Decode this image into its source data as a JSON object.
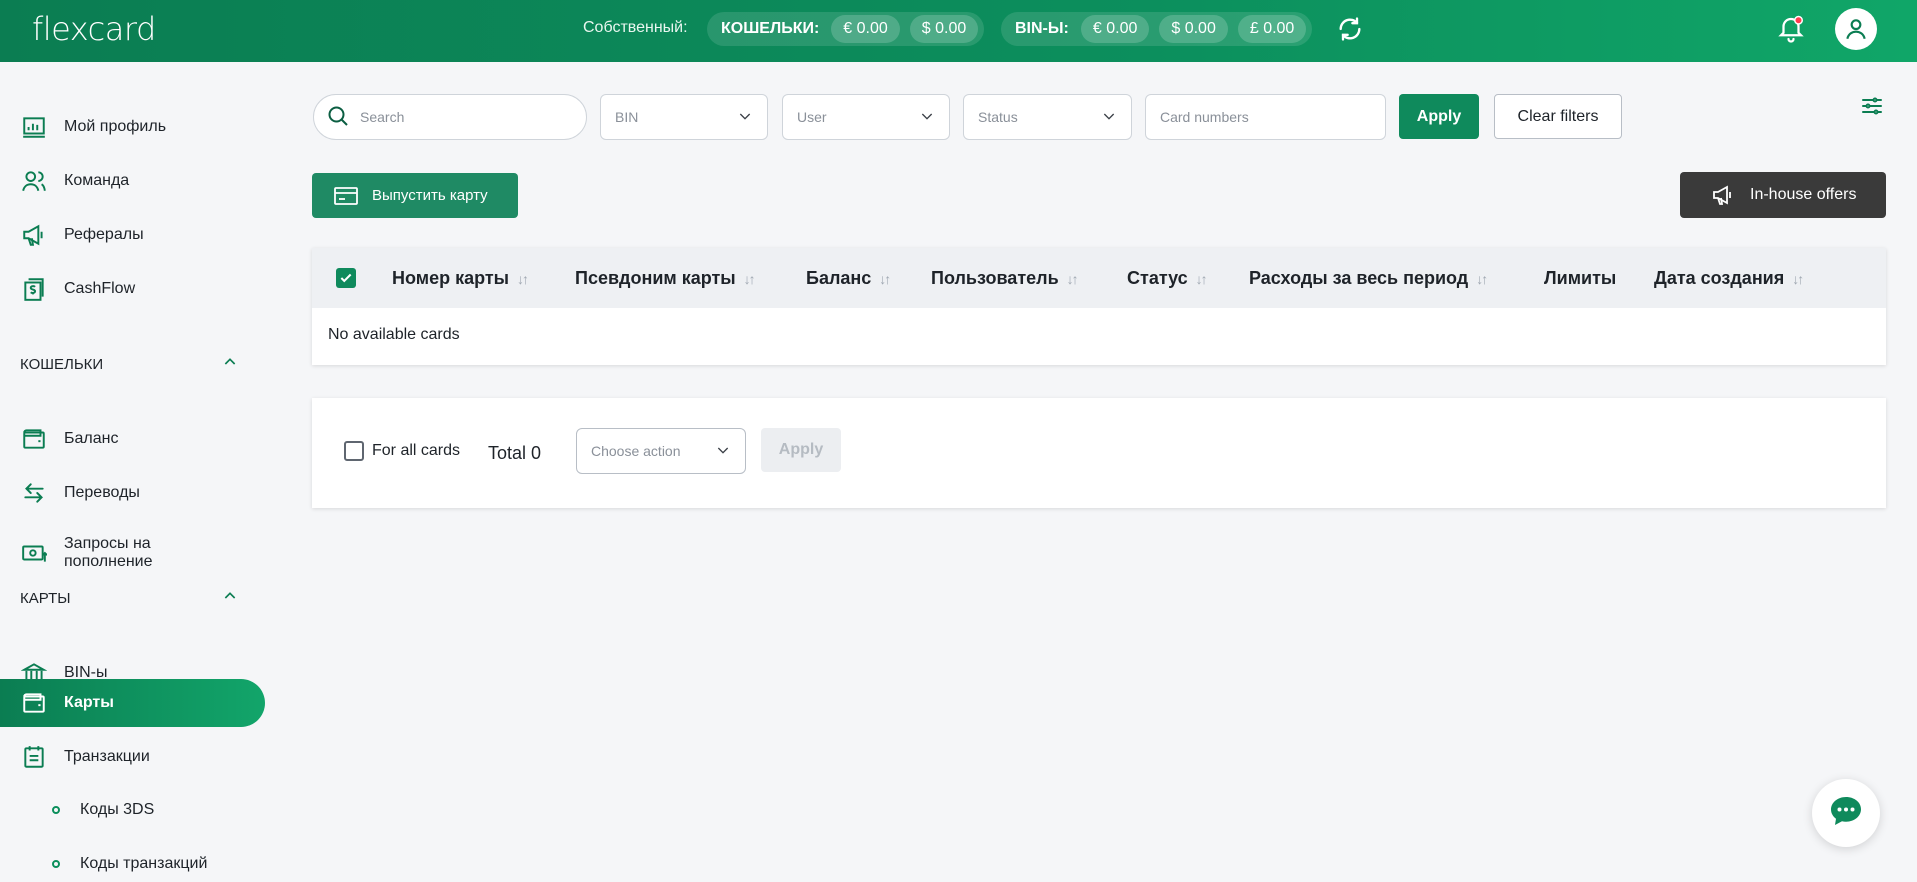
{
  "header": {
    "logo": "flexcard",
    "owned_label": "Собственный:",
    "wallets_label": "КОШЕЛЬКИ:",
    "wallets": [
      "€ 0.00",
      "$ 0.00"
    ],
    "bins_label": "BIN-Ы:",
    "bins": [
      "€ 0.00",
      "$ 0.00",
      "£ 0.00"
    ]
  },
  "sidebar": {
    "items": [
      {
        "label": "Мой профиль",
        "icon": "profile-chart-icon"
      },
      {
        "label": "Команда",
        "icon": "team-icon"
      },
      {
        "label": "Рефералы",
        "icon": "megaphone-icon"
      },
      {
        "label": "CashFlow",
        "icon": "cashflow-icon"
      }
    ],
    "wallets_section": "КОШЕЛЬКИ",
    "wallet_items": [
      {
        "label": "Баланс",
        "icon": "wallet-icon"
      },
      {
        "label": "Переводы",
        "icon": "transfer-icon"
      },
      {
        "label": "Запросы на пополнение",
        "icon": "topup-icon"
      }
    ],
    "cards_section": "КАРТЫ",
    "card_items": [
      {
        "label": "BIN-ы",
        "icon": "bank-icon"
      },
      {
        "label": "Карты",
        "icon": "card-icon",
        "active": true
      },
      {
        "label": "Транзакции",
        "icon": "transactions-icon"
      }
    ],
    "sub_items": [
      "Коды 3DS",
      "Коды транзакций"
    ]
  },
  "filters": {
    "search_placeholder": "Search",
    "bin": "BIN",
    "user": "User",
    "status": "Status",
    "card_numbers_placeholder": "Card numbers",
    "apply": "Apply",
    "clear": "Clear filters"
  },
  "actions": {
    "issue_card": "Выпустить карту",
    "in_house_offers": "In-house offers"
  },
  "table": {
    "columns": [
      "Номер карты",
      "Псевдоним карты",
      "Баланс",
      "Пользователь",
      "Статус",
      "Расходы за весь период",
      "Лимиты",
      "Дата создания"
    ],
    "empty_text": "No available cards"
  },
  "bulk": {
    "for_all_cards": "For all cards",
    "total": "Total 0",
    "choose_action": "Choose action",
    "apply": "Apply"
  },
  "colors": {
    "brand": "#0f8a5c",
    "dark_button": "#3a3a3a"
  }
}
